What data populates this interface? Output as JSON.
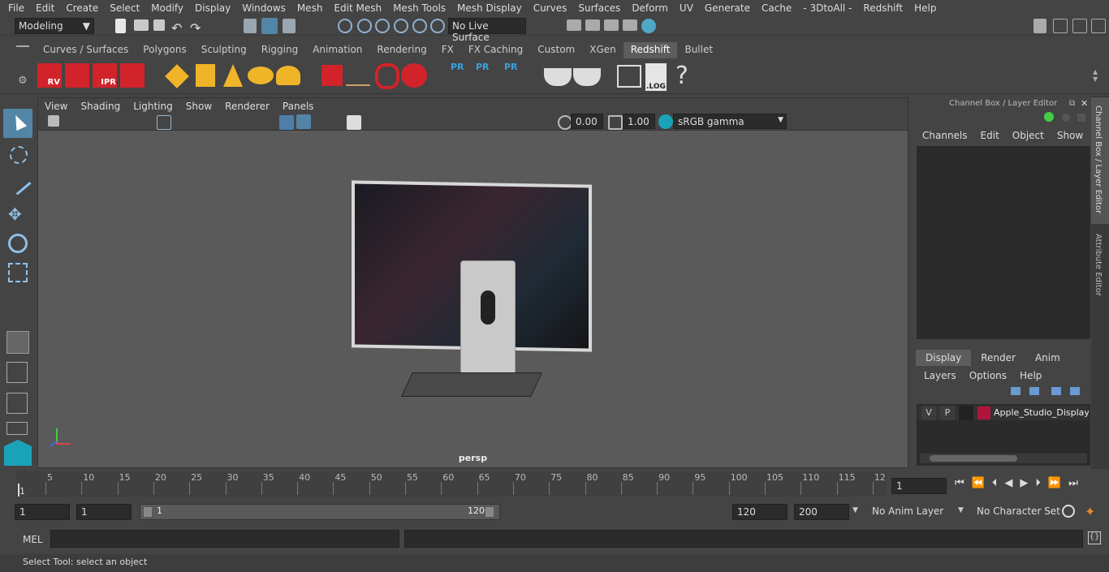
{
  "menu": [
    "File",
    "Edit",
    "Create",
    "Select",
    "Modify",
    "Display",
    "Windows",
    "Mesh",
    "Edit Mesh",
    "Mesh Tools",
    "Mesh Display",
    "Curves",
    "Surfaces",
    "Deform",
    "UV",
    "Generate",
    "Cache",
    "- 3DtoAll -",
    "Redshift",
    "Help"
  ],
  "status": {
    "mode": "Modeling",
    "live_surface": "No Live Surface"
  },
  "shelf_tabs": [
    "Curves / Surfaces",
    "Polygons",
    "Sculpting",
    "Rigging",
    "Animation",
    "Rendering",
    "FX",
    "FX Caching",
    "Custom",
    "XGen",
    "Redshift",
    "Bullet"
  ],
  "shelf_active": "Redshift",
  "shelf_labels": {
    "rv": "RV",
    "ipr": "IPR",
    "pr1": "PR",
    "pr2": "PR",
    "pr3": "PR",
    "log": ".LOG",
    "help": "?"
  },
  "viewport": {
    "menu": [
      "View",
      "Shading",
      "Lighting",
      "Show",
      "Renderer",
      "Panels"
    ],
    "exposure": "0.00",
    "gamma": "1.00",
    "colorspace": "sRGB gamma",
    "camera": "persp"
  },
  "channel_box": {
    "title": "Channel Box / Layer Editor",
    "menu": [
      "Channels",
      "Edit",
      "Object",
      "Show"
    ],
    "tabs": [
      "Display",
      "Render",
      "Anim"
    ],
    "layer_menu": [
      "Layers",
      "Options",
      "Help"
    ],
    "layer": {
      "v": "V",
      "p": "P",
      "name": "Apple_Studio_Display_"
    }
  },
  "side_tabs": {
    "channel": "Channel Box / Layer Editor",
    "attribute": "Attribute Editor"
  },
  "timeline": {
    "ticks": [
      "5",
      "10",
      "15",
      "20",
      "25",
      "30",
      "35",
      "40",
      "45",
      "50",
      "55",
      "60",
      "65",
      "70",
      "75",
      "80",
      "85",
      "90",
      "95",
      "100",
      "105",
      "110",
      "115",
      "12"
    ],
    "start_label": "1",
    "current": "1"
  },
  "range": {
    "start": "1",
    "playback_start": "1",
    "slider_start": "1",
    "slider_end": "120",
    "end": "120",
    "anim_end": "200",
    "anim_layer": "No Anim Layer",
    "char_set": "No Character Set"
  },
  "mel": {
    "label": "MEL"
  },
  "help": "Select Tool: select an object",
  "colors": {
    "layer": "#b0143a",
    "accent": "#5285a6"
  }
}
